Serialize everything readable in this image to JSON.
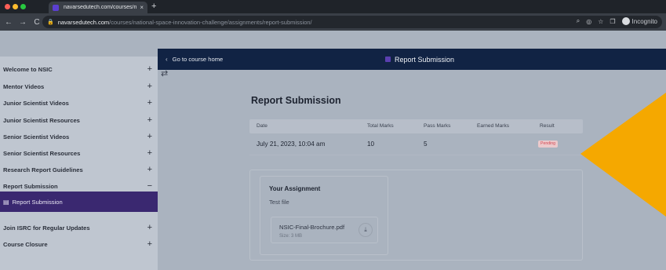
{
  "browser": {
    "tab_title": "navarsedutech.com/courses/n",
    "tab_close": "×",
    "new_tab": "+",
    "url_host": "navarsedutech.com",
    "url_path": "/courses/national-space-innovation-challenge/assignments/report-submission/",
    "incognito_label": "Incognito",
    "nav_back": "←",
    "nav_forward": "→",
    "nav_reload": "C",
    "lock_icon": "🔒",
    "zoom_icon": "⌕",
    "eye_icon": "◎",
    "star_icon": "☆",
    "split_icon": "❐"
  },
  "header": {
    "go_home_label": "Go to course home",
    "title": "Report Submission"
  },
  "sidebar": {
    "items": [
      {
        "label": "Welcome to NSIC",
        "toggle": "+"
      },
      {
        "label": "Mentor Videos",
        "toggle": "+"
      },
      {
        "label": "Junior Scientist Videos",
        "toggle": "+"
      },
      {
        "label": "Junior Scientist Resources",
        "toggle": "+"
      },
      {
        "label": "Senior Scientist Videos",
        "toggle": "+"
      },
      {
        "label": "Senior Scientist Resources",
        "toggle": "+"
      },
      {
        "label": "Research Report Guidelines",
        "toggle": "+"
      },
      {
        "label": "Report Submission",
        "toggle": "−"
      },
      {
        "label": "Join ISRC for Regular Updates",
        "toggle": "+"
      },
      {
        "label": "Course Closure",
        "toggle": "+"
      }
    ],
    "active_item": "Report Submission"
  },
  "main": {
    "page_title": "Report Submission",
    "table": {
      "headers": [
        "Date",
        "Total Marks",
        "Pass Marks",
        "Earned Marks",
        "Result"
      ],
      "row": {
        "date": "July 21, 2023, 10:04 am",
        "total_marks": "10",
        "pass_marks": "5",
        "earned_marks": "",
        "result": "Pending"
      }
    },
    "assignment": {
      "title": "Your Assignment",
      "description": "Test file",
      "file_name": "NSIC-Final-Brochure.pdf",
      "file_size": "Size: 3 MB"
    }
  },
  "colors": {
    "header_bg": "#112344",
    "active_item_bg": "#3a2870",
    "arrow": "#f5a800",
    "pending_text": "#d34a55"
  }
}
